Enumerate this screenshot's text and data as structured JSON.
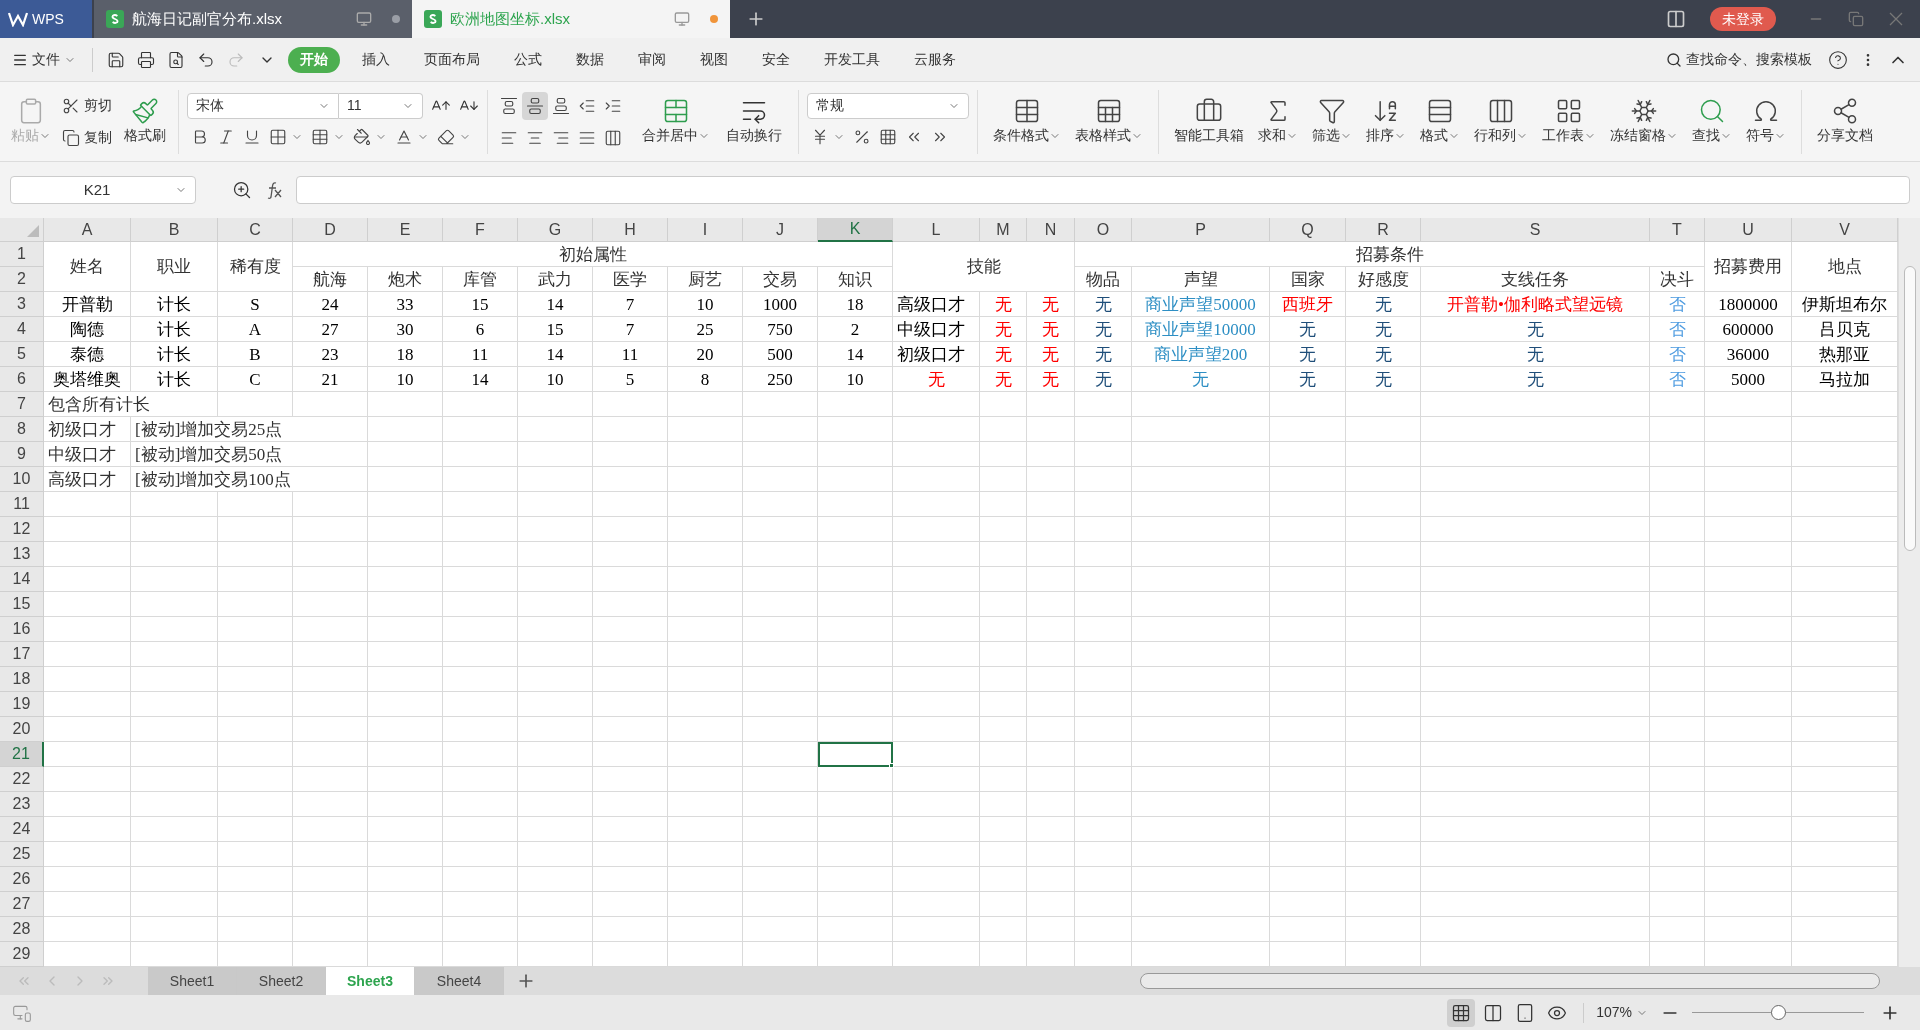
{
  "titlebar": {
    "app": "WPS",
    "tabs": [
      {
        "label": "航海日记副官分布.xlsx",
        "selected": false,
        "modified": false
      },
      {
        "label": "欧洲地图坐标.xlsx",
        "selected": true,
        "modified": true
      }
    ],
    "login": "未登录"
  },
  "menu": {
    "file": "文件",
    "tabs": [
      {
        "label": "开始",
        "selected": true
      },
      {
        "label": "插入",
        "selected": false
      },
      {
        "label": "页面布局",
        "selected": false
      },
      {
        "label": "公式",
        "selected": false
      },
      {
        "label": "数据",
        "selected": false
      },
      {
        "label": "审阅",
        "selected": false
      },
      {
        "label": "视图",
        "selected": false
      },
      {
        "label": "安全",
        "selected": false
      },
      {
        "label": "开发工具",
        "selected": false
      },
      {
        "label": "云服务",
        "selected": false
      }
    ],
    "search": "查找命令、搜索模板"
  },
  "ribbon": {
    "paste": {
      "label": "粘贴",
      "disabled": true
    },
    "cut": "剪切",
    "copy": "复制",
    "format_painter": "格式刷",
    "font_family": "宋体",
    "font_size": "11",
    "merge": "合并居中",
    "wrap": "自动换行",
    "number_format": "常规",
    "tools": [
      {
        "label": "条件格式",
        "dropdown": true
      },
      {
        "label": "表格样式",
        "dropdown": true
      },
      {
        "label": "智能工具箱",
        "dropdown": false
      },
      {
        "label": "求和",
        "dropdown": true
      },
      {
        "label": "筛选",
        "dropdown": true
      },
      {
        "label": "排序",
        "dropdown": true
      },
      {
        "label": "格式",
        "dropdown": true
      },
      {
        "label": "行和列",
        "dropdown": true
      },
      {
        "label": "工作表",
        "dropdown": true
      },
      {
        "label": "冻结窗格",
        "dropdown": true
      },
      {
        "label": "查找",
        "dropdown": true
      },
      {
        "label": "符号",
        "dropdown": true
      },
      {
        "label": "分享文档",
        "dropdown": false
      }
    ]
  },
  "formula_bar": {
    "name_box": "K21"
  },
  "columns": [
    {
      "label": "A",
      "selected": false
    },
    {
      "label": "B",
      "selected": false
    },
    {
      "label": "C",
      "selected": false
    },
    {
      "label": "D",
      "selected": false
    },
    {
      "label": "E",
      "selected": false
    },
    {
      "label": "F",
      "selected": false
    },
    {
      "label": "G",
      "selected": false
    },
    {
      "label": "H",
      "selected": false
    },
    {
      "label": "I",
      "selected": false
    },
    {
      "label": "J",
      "selected": false
    },
    {
      "label": "K",
      "selected": true
    },
    {
      "label": "L",
      "selected": false
    },
    {
      "label": "M",
      "selected": false
    },
    {
      "label": "N",
      "selected": false
    },
    {
      "label": "O",
      "selected": false
    },
    {
      "label": "P",
      "selected": false
    },
    {
      "label": "Q",
      "selected": false
    },
    {
      "label": "R",
      "selected": false
    },
    {
      "label": "S",
      "selected": false
    },
    {
      "label": "T",
      "selected": false
    },
    {
      "label": "U",
      "selected": false
    },
    {
      "label": "V",
      "selected": false
    }
  ],
  "row_numbers": [
    {
      "label": "1",
      "selected": false
    },
    {
      "label": "2",
      "selected": false
    },
    {
      "label": "3",
      "selected": false
    },
    {
      "label": "4",
      "selected": false
    },
    {
      "label": "5",
      "selected": false
    },
    {
      "label": "6",
      "selected": false
    },
    {
      "label": "7",
      "selected": false
    },
    {
      "label": "8",
      "selected": false
    },
    {
      "label": "9",
      "selected": false
    },
    {
      "label": "10",
      "selected": false
    },
    {
      "label": "11",
      "selected": false
    },
    {
      "label": "12",
      "selected": false
    },
    {
      "label": "13",
      "selected": false
    },
    {
      "label": "14",
      "selected": false
    },
    {
      "label": "15",
      "selected": false
    },
    {
      "label": "16",
      "selected": false
    },
    {
      "label": "17",
      "selected": false
    },
    {
      "label": "18",
      "selected": false
    },
    {
      "label": "19",
      "selected": false
    },
    {
      "label": "20",
      "selected": false
    },
    {
      "label": "21",
      "selected": true
    },
    {
      "label": "22",
      "selected": false
    },
    {
      "label": "23",
      "selected": false
    },
    {
      "label": "24",
      "selected": false
    },
    {
      "label": "25",
      "selected": false
    },
    {
      "label": "26",
      "selected": false
    },
    {
      "label": "27",
      "selected": false
    },
    {
      "label": "28",
      "selected": false
    },
    {
      "label": "29",
      "selected": false
    }
  ],
  "table_header": {
    "name": "姓名",
    "job": "职业",
    "rarity": "稀有度",
    "attributes": {
      "title": "初始属性",
      "items": [
        "航海",
        "炮术",
        "库管",
        "武力",
        "医学",
        "厨艺",
        "交易",
        "知识"
      ]
    },
    "skills": "技能",
    "recruit": {
      "title": "招募条件",
      "items": [
        "物品",
        "声望",
        "国家",
        "好感度",
        "支线任务",
        "决斗"
      ]
    },
    "cost": "招募费用",
    "location": "地点"
  },
  "rows": [
    {
      "cells": [
        {
          "text": "开普勒"
        },
        {
          "text": "计长"
        },
        {
          "text": "S"
        },
        {
          "text": "24"
        },
        {
          "text": "33"
        },
        {
          "text": "15"
        },
        {
          "text": "14"
        },
        {
          "text": "7"
        },
        {
          "text": "10"
        },
        {
          "text": "1000"
        },
        {
          "text": "18"
        },
        {
          "text": "高级口才"
        },
        {
          "text": "无",
          "color": "#ff0000"
        },
        {
          "text": "无",
          "color": "#ff0000"
        },
        {
          "text": "无",
          "color": "#1f4e79"
        },
        {
          "text": "商业声望50000",
          "color": "#2e8fc4"
        },
        {
          "text": "西班牙",
          "color": "#ff0000"
        },
        {
          "text": "无",
          "color": "#1f4e79"
        },
        {
          "text": "开普勒•伽利略式望远镜",
          "color": "#ff0000"
        },
        {
          "text": "否",
          "color": "#4d9be0"
        },
        {
          "text": "1800000"
        },
        {
          "text": "伊斯坦布尔"
        }
      ]
    },
    {
      "cells": [
        {
          "text": "陶德"
        },
        {
          "text": "计长"
        },
        {
          "text": "A"
        },
        {
          "text": "27"
        },
        {
          "text": "30"
        },
        {
          "text": "6"
        },
        {
          "text": "15"
        },
        {
          "text": "7"
        },
        {
          "text": "25"
        },
        {
          "text": "750"
        },
        {
          "text": "2"
        },
        {
          "text": "中级口才"
        },
        {
          "text": "无",
          "color": "#ff0000"
        },
        {
          "text": "无",
          "color": "#ff0000"
        },
        {
          "text": "无",
          "color": "#1f4e79"
        },
        {
          "text": "商业声望10000",
          "color": "#2e8fc4"
        },
        {
          "text": "无",
          "color": "#1f4e79"
        },
        {
          "text": "无",
          "color": "#1f4e79"
        },
        {
          "text": "无",
          "color": "#1f4e79"
        },
        {
          "text": "否",
          "color": "#4d9be0"
        },
        {
          "text": "600000"
        },
        {
          "text": "吕贝克"
        }
      ]
    },
    {
      "cells": [
        {
          "text": "泰德"
        },
        {
          "text": "计长"
        },
        {
          "text": "B"
        },
        {
          "text": "23"
        },
        {
          "text": "18"
        },
        {
          "text": "11"
        },
        {
          "text": "14"
        },
        {
          "text": "11"
        },
        {
          "text": "20"
        },
        {
          "text": "500"
        },
        {
          "text": "14"
        },
        {
          "text": "初级口才"
        },
        {
          "text": "无",
          "color": "#ff0000"
        },
        {
          "text": "无",
          "color": "#ff0000"
        },
        {
          "text": "无",
          "color": "#1f4e79"
        },
        {
          "text": "商业声望200",
          "color": "#2e8fc4"
        },
        {
          "text": "无",
          "color": "#1f4e79"
        },
        {
          "text": "无",
          "color": "#1f4e79"
        },
        {
          "text": "无",
          "color": "#1f4e79"
        },
        {
          "text": "否",
          "color": "#4d9be0"
        },
        {
          "text": "36000"
        },
        {
          "text": "热那亚"
        }
      ]
    },
    {
      "cells": [
        {
          "text": "奥塔维奥"
        },
        {
          "text": "计长"
        },
        {
          "text": "C"
        },
        {
          "text": "21"
        },
        {
          "text": "10"
        },
        {
          "text": "14"
        },
        {
          "text": "10"
        },
        {
          "text": "5"
        },
        {
          "text": "8"
        },
        {
          "text": "250"
        },
        {
          "text": "10"
        },
        {
          "text": "无",
          "color": "#ff0000"
        },
        {
          "text": "无",
          "color": "#ff0000"
        },
        {
          "text": "无",
          "color": "#ff0000"
        },
        {
          "text": "无",
          "color": "#1f4e79"
        },
        {
          "text": "无",
          "color": "#2e8fc4"
        },
        {
          "text": "无",
          "color": "#1f4e79"
        },
        {
          "text": "无",
          "color": "#1f4e79"
        },
        {
          "text": "无",
          "color": "#1f4e79"
        },
        {
          "text": "否",
          "color": "#4d9be0"
        },
        {
          "text": "5000"
        },
        {
          "text": "马拉加"
        }
      ]
    }
  ],
  "notes": [
    {
      "cells": [
        "包含所有计长"
      ]
    },
    {
      "cells": [
        "初级口才",
        "[被动]增加交易25点"
      ]
    },
    {
      "cells": [
        "中级口才",
        "[被动]增加交易50点"
      ]
    },
    {
      "cells": [
        "高级口才",
        "[被动]增加交易100点"
      ]
    }
  ],
  "sheets": [
    {
      "label": "Sheet1",
      "selected": false
    },
    {
      "label": "Sheet2",
      "selected": false
    },
    {
      "label": "Sheet3",
      "selected": true
    },
    {
      "label": "Sheet4",
      "selected": false
    }
  ],
  "status_bar": {
    "zoom": "107%",
    "zoom_slider": {
      "level": 0.5
    }
  }
}
